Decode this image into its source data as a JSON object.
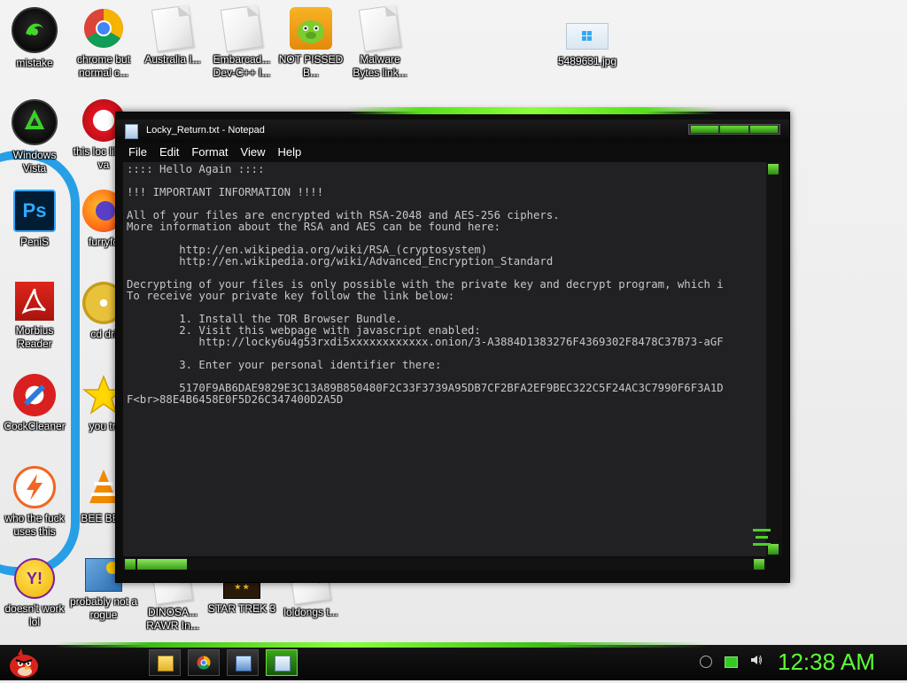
{
  "desktop": {
    "icons": [
      {
        "label": "mistake",
        "icon": "razer-icon"
      },
      {
        "label": "chrome but normal c...",
        "icon": "chrome-icon"
      },
      {
        "label": "Australia I...",
        "icon": "document-icon"
      },
      {
        "label": "Embarcad... Dev-C++ I...",
        "icon": "document-icon"
      },
      {
        "label": "NOT PISSED B...",
        "icon": "pig-icon"
      },
      {
        "label": "Malware Bytes link...",
        "icon": "document-icon"
      },
      {
        "label": "5489631.jpg",
        "icon": "image-file-icon"
      },
      {
        "label": "Windows Vista",
        "icon": "recycle-bin-icon"
      },
      {
        "label": "this loc like a va",
        "icon": "opera-icon"
      },
      {
        "label": "PeniS",
        "icon": "photoshop-icon"
      },
      {
        "label": "furryfo",
        "icon": "firefox-icon"
      },
      {
        "label": "Morbius Reader",
        "icon": "pdf-reader-icon"
      },
      {
        "label": "cd dri",
        "icon": "cd-icon"
      },
      {
        "label": "CockCleaner",
        "icon": "ccleaner-icon"
      },
      {
        "label": "you tri",
        "icon": "star-icon"
      },
      {
        "label": "who the fuck uses this",
        "icon": "avast-icon"
      },
      {
        "label": "BEE BEE",
        "icon": "vlc-icon"
      },
      {
        "label": "doesn't work lol",
        "icon": "yahoo-messenger-icon"
      },
      {
        "label": "probably not a rogue",
        "icon": "rogue-program-icon"
      },
      {
        "label": "DINOSA... RAWR In...",
        "icon": "document-icon"
      },
      {
        "label": "STAR TREK 3",
        "icon": "star-wars-icon"
      },
      {
        "label": "loldongs t...",
        "icon": "document-icon"
      }
    ]
  },
  "notepad": {
    "title": "Locky_Return.txt - Notepad",
    "menu": [
      "File",
      "Edit",
      "Format",
      "View",
      "Help"
    ],
    "content": ":::: Hello Again ::::\n\n!!! IMPORTANT INFORMATION !!!!\n\nAll of your files are encrypted with RSA-2048 and AES-256 ciphers.\nMore information about the RSA and AES can be found here:\n\n        http://en.wikipedia.org/wiki/RSA_(cryptosystem)\n        http://en.wikipedia.org/wiki/Advanced_Encryption_Standard\n\nDecrypting of your files is only possible with the private key and decrypt program, which i\nTo receive your private key follow the link below:\n\n        1. Install the TOR Browser Bundle.\n        2. Visit this webpage with javascript enabled:\n           http://locky6u4g53rxdi5xxxxxxxxxxxx.onion/3-A3884D1383276F4369302F8478C37B73-aGF\n\n        3. Enter your personal identifier there:\n\n        5170F9AB6DAE9829E3C13A89B850480F2C33F3739A95DB7CF2BFA2EF9BEC322C5F24AC3C7990F6F3A1D\nF<br>88E4B6458E0F5D26C347400D2A5D"
  },
  "taskbar": {
    "items": [
      "windows-explorer-icon",
      "chrome-icon",
      "media-center-icon",
      "notepad-icon"
    ],
    "tray": [
      "network-icon",
      "battery-icon",
      "volume-icon"
    ],
    "clock": "12:38 AM"
  },
  "colors": {
    "accent_green": "#5cff36",
    "taskbar_bg": "#0b0b0b",
    "editor_bg": "#212124",
    "editor_text": "#c7c7c7"
  }
}
